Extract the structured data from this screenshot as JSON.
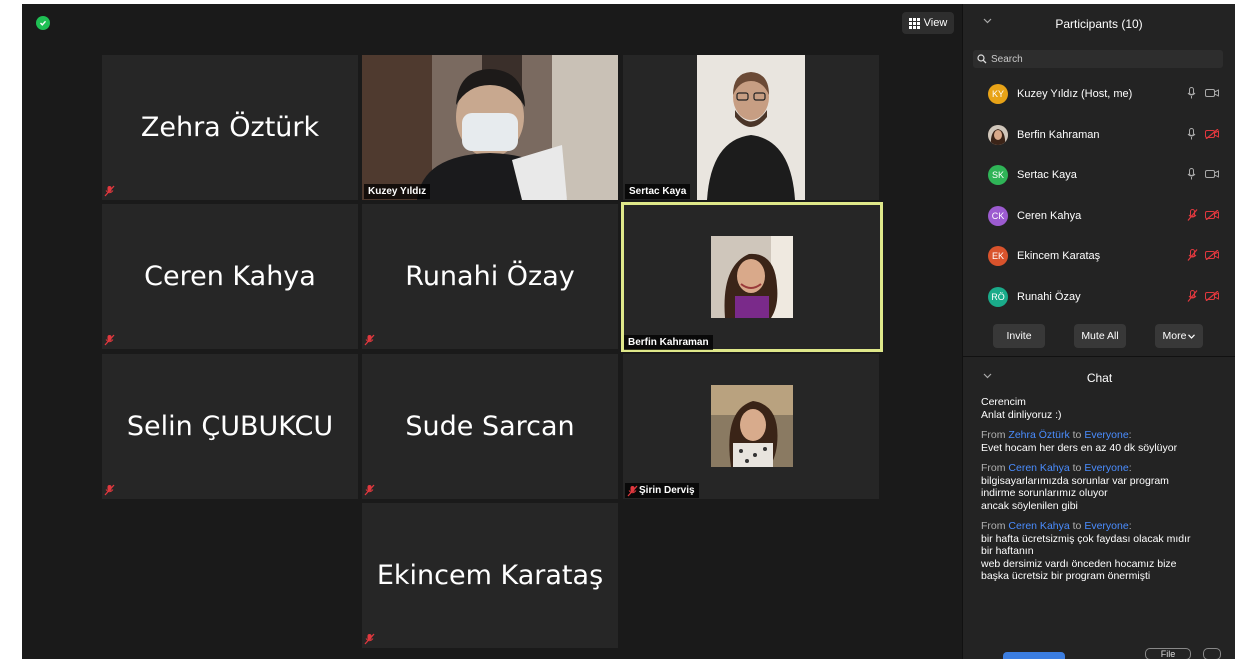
{
  "toolbar": {
    "view_label": "View"
  },
  "tiles": [
    {
      "display_name": "Zehra Öztürk"
    },
    {
      "label": "Kuzey Yıldız"
    },
    {
      "label": "Sertac Kaya"
    },
    {
      "display_name": "Ceren Kahya"
    },
    {
      "display_name": "Runahi Özay"
    },
    {
      "label": "Berfin Kahraman"
    },
    {
      "display_name": "Selin ÇUBUKCU"
    },
    {
      "display_name": "Sude Sarcan"
    },
    {
      "label": "Şirin Derviş"
    },
    {
      "display_name": "Ekincem Karataş"
    }
  ],
  "participants": {
    "title": "Participants (10)",
    "search_placeholder": "Search",
    "list": [
      {
        "initials": "KY",
        "name": "Kuzey Yıldız (Host, me)",
        "avatar_color": "#e8a317",
        "mic": "on",
        "camera": "on"
      },
      {
        "initials": "",
        "name": "Berfin Kahraman",
        "avatar_color": "#8a6a55",
        "mic": "on",
        "camera": "off"
      },
      {
        "initials": "SK",
        "name": "Sertac Kaya",
        "avatar_color": "#2fb457",
        "mic": "on",
        "camera": "on"
      },
      {
        "initials": "CK",
        "name": "Ceren Kahya",
        "avatar_color": "#9c5bd0",
        "mic": "off",
        "camera": "off"
      },
      {
        "initials": "EK",
        "name": "Ekincem Karataş",
        "avatar_color": "#d9532c",
        "mic": "off",
        "camera": "off"
      },
      {
        "initials": "RÖ",
        "name": "Runahi Özay",
        "avatar_color": "#1aab8a",
        "mic": "off",
        "camera": "off"
      }
    ],
    "buttons": {
      "invite": "Invite",
      "mute_all": "Mute All",
      "more": "More"
    }
  },
  "chat": {
    "title": "Chat",
    "messages": [
      {
        "lines": [
          "Cerencim",
          "Anlat dinliyoruz :)"
        ]
      },
      {
        "from_prefix": "From",
        "sender": "Zehra Öztürk",
        "to_word": "to",
        "recipient": "Everyone",
        "lines": [
          "Evet hocam her ders en az 40 dk söylüyor"
        ]
      },
      {
        "from_prefix": "From",
        "sender": "Ceren Kahya",
        "to_word": "to",
        "recipient": "Everyone",
        "lines": [
          "bilgisayarlarımızda sorunlar var program",
          "indirme sorunlarımız oluyor",
          "ancak söylenilen gibi"
        ]
      },
      {
        "from_prefix": "From",
        "sender": "Ceren Kahya",
        "to_word": "to",
        "recipient": "Everyone",
        "lines": [
          "bir hafta ücretsizmiş çok faydası olacak mıdır",
          "bir haftanın",
          "web dersimiz vardı önceden hocamız bize",
          "başka ücretsiz bir program önermişti"
        ]
      }
    ],
    "file_label": "File"
  },
  "colors": {
    "accent_blue": "#4a8dff",
    "active_speaker": "#dfe88a",
    "muted_red": "#e0383e"
  },
  "icons": [
    "shield-icon",
    "grid-view-icon",
    "search-icon",
    "mic-icon",
    "mic-muted-icon",
    "camera-icon",
    "camera-off-icon",
    "chevron-down-icon"
  ]
}
